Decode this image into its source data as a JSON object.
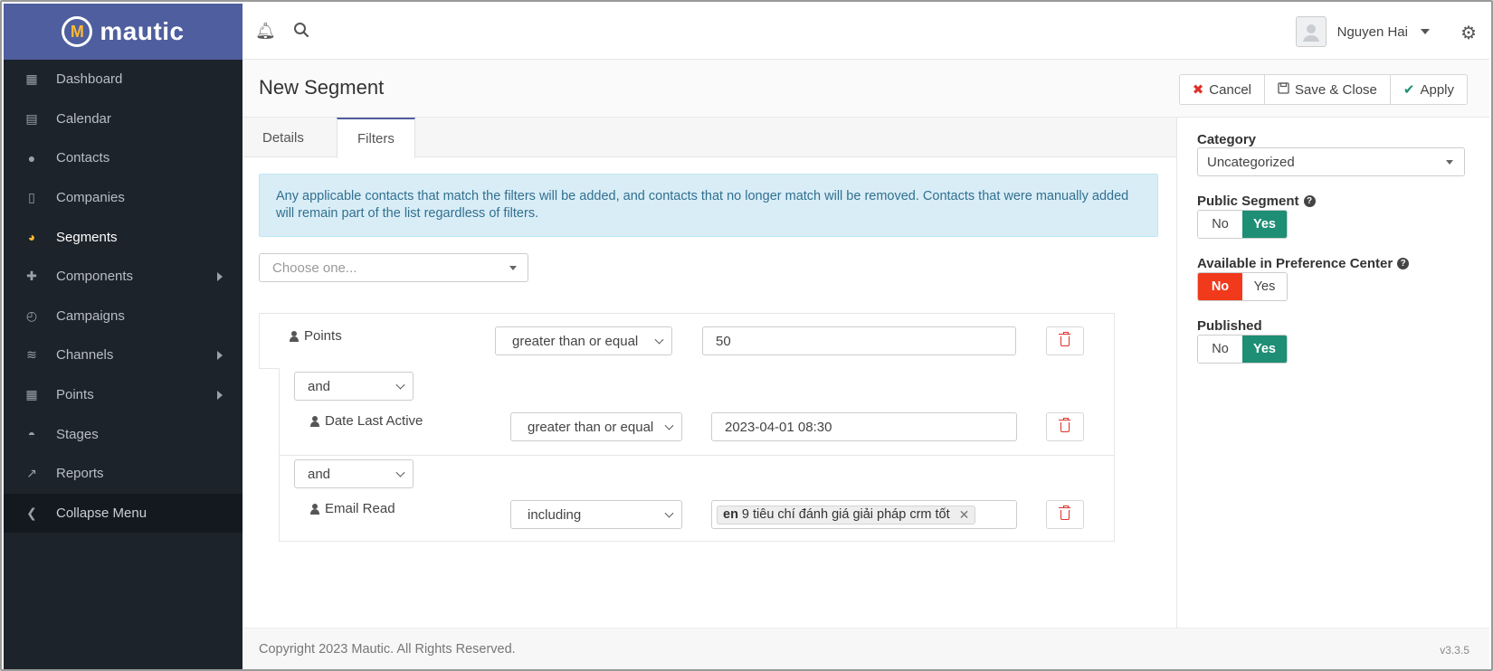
{
  "app": {
    "logo_text": "mautic",
    "logo_mark": "M"
  },
  "sidebar": {
    "items": [
      {
        "label": "Dashboard",
        "icon": "dashboard-icon",
        "glyph": "▦"
      },
      {
        "label": "Calendar",
        "icon": "calendar-icon",
        "glyph": "▤"
      },
      {
        "label": "Contacts",
        "icon": "user-icon",
        "glyph": "●"
      },
      {
        "label": "Companies",
        "icon": "building-icon",
        "glyph": "▯"
      },
      {
        "label": "Segments",
        "icon": "pie-chart-icon",
        "glyph": "◕"
      },
      {
        "label": "Components",
        "icon": "puzzle-icon",
        "glyph": "✚"
      },
      {
        "label": "Campaigns",
        "icon": "clock-icon",
        "glyph": "◴"
      },
      {
        "label": "Channels",
        "icon": "rss-icon",
        "glyph": "≋"
      },
      {
        "label": "Points",
        "icon": "calculator-icon",
        "glyph": "▦"
      },
      {
        "label": "Stages",
        "icon": "tachometer-icon",
        "glyph": "◓"
      },
      {
        "label": "Reports",
        "icon": "line-chart-icon",
        "glyph": "↗"
      },
      {
        "label": "Collapse Menu",
        "icon": "chevron-left-icon",
        "glyph": "❮"
      }
    ]
  },
  "topbar": {
    "user_name": "Nguyen Hai"
  },
  "header": {
    "title": "New Segment",
    "cancel_label": "Cancel",
    "save_close_label": "Save & Close",
    "apply_label": "Apply"
  },
  "tabs": {
    "details": "Details",
    "filters": "Filters"
  },
  "alert": {
    "text": "Any applicable contacts that match the filters will be added, and contacts that no longer match will be removed. Contacts that were manually added will remain part of the list regardless of filters."
  },
  "filter_chooser": {
    "placeholder": "Choose one..."
  },
  "filters": [
    {
      "glue": "",
      "field": "Points",
      "operator": "greater than or equal",
      "value": "50"
    },
    {
      "glue": "and",
      "field": "Date Last Active",
      "operator": "greater than or equal",
      "value": "2023-04-01 08:30"
    },
    {
      "glue": "and",
      "field": "Email Read",
      "operator": "including",
      "tag_lang": "en",
      "tag_text": "9 tiêu chí đánh giá giải pháp crm tốt"
    }
  ],
  "right_panel": {
    "category_label": "Category",
    "category_value": "Uncategorized",
    "public_label": "Public Segment",
    "public_value": "Yes",
    "pref_center_label": "Available in Preference Center",
    "pref_center_value": "No",
    "published_label": "Published",
    "published_value": "Yes",
    "no_label": "No",
    "yes_label": "Yes"
  },
  "footer": {
    "copyright": "Copyright 2023 Mautic. All Rights Reserved.",
    "version": "v3.3.5"
  },
  "colors": {
    "sidebar_bg": "#1d232b",
    "logo_bg": "#4e5e9e",
    "accent_green": "#1e8e75",
    "accent_red": "#f13a1c",
    "alert_bg": "#d9edf7",
    "active_icon": "#fdb933"
  }
}
